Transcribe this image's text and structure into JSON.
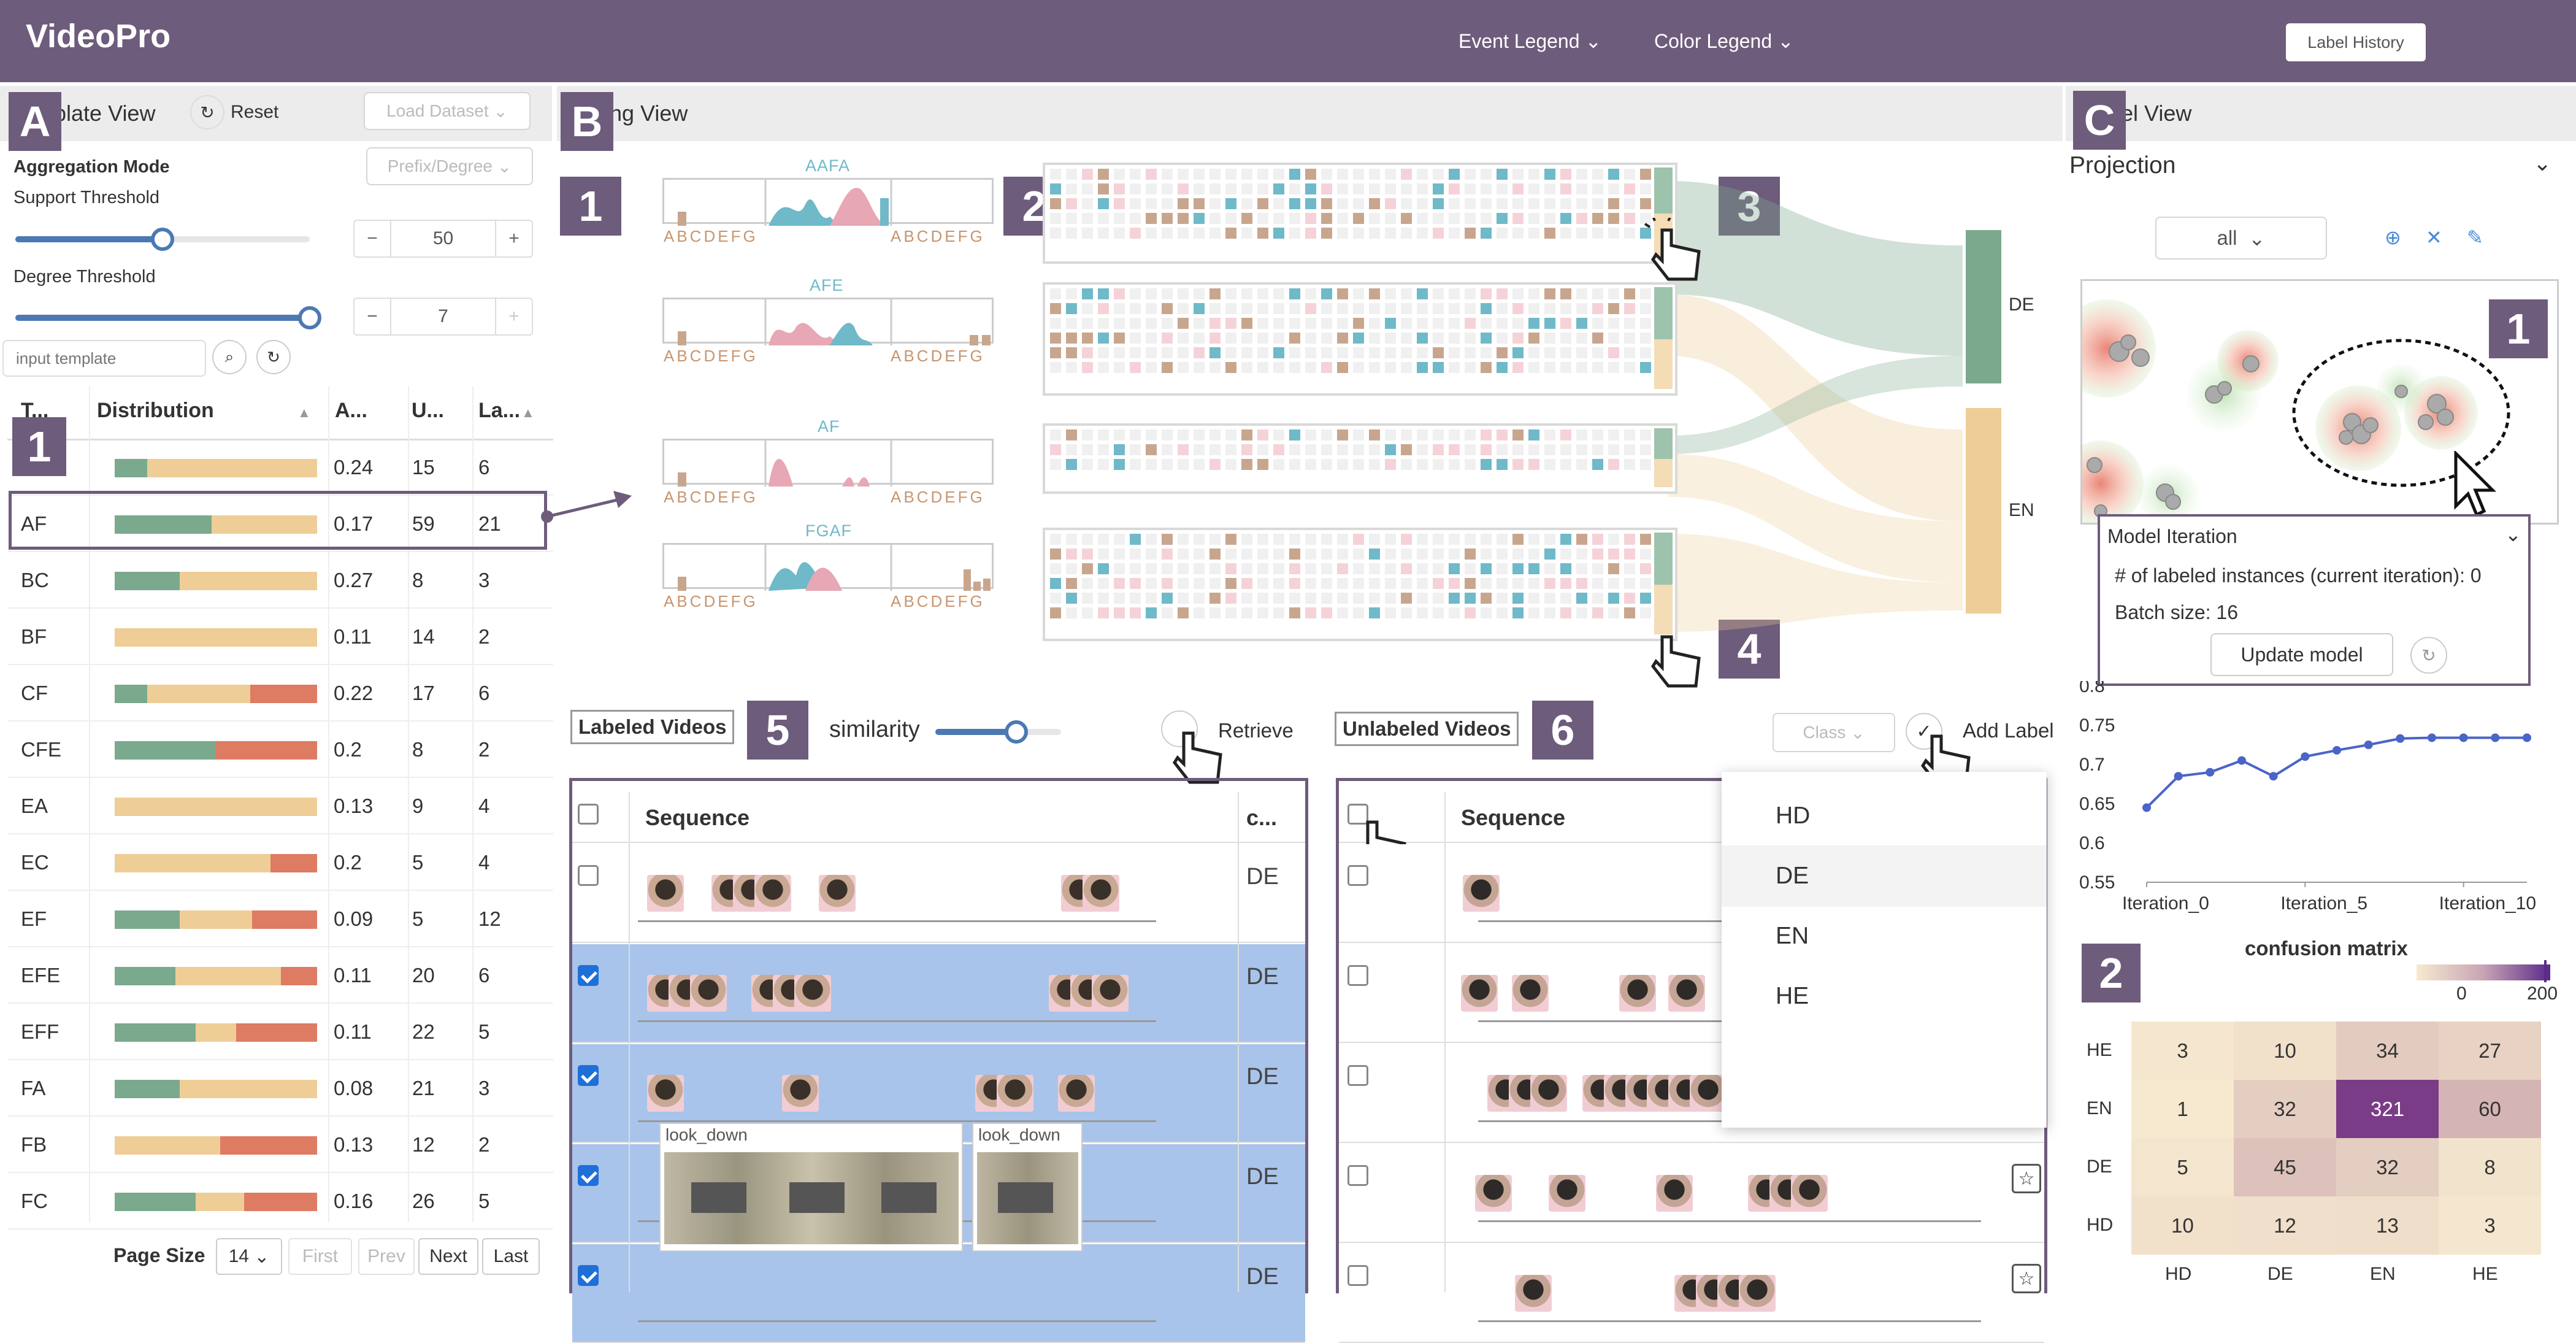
{
  "app": {
    "title": "VideoPro",
    "event_legend": "Event Legend",
    "color_legend": "Color Legend",
    "label_history": "Label History"
  },
  "template_view": {
    "title": "Template View",
    "badge": "A",
    "reset": "Reset",
    "load_dataset": "Load Dataset",
    "aggregation_mode_label": "Aggregation Mode",
    "aggregation_mode_value": "Prefix/Degree",
    "support_threshold_label": "Support Threshold",
    "support_threshold": "50",
    "degree_threshold_label": "Degree Threshold",
    "degree_threshold": "7",
    "input_placeholder": "input template",
    "table_badge": "1",
    "columns": [
      "T...",
      "Distribution",
      "A...",
      "U...",
      "La..."
    ],
    "rows": [
      {
        "t": "",
        "a": "0.24",
        "u": "15",
        "la": "6",
        "dist": [
          0.16,
          0.84,
          0
        ]
      },
      {
        "t": "AF",
        "a": "0.17",
        "u": "59",
        "la": "21",
        "dist": [
          0.48,
          0.52,
          0
        ]
      },
      {
        "t": "BC",
        "a": "0.27",
        "u": "8",
        "la": "3",
        "dist": [
          0.32,
          0.68,
          0
        ]
      },
      {
        "t": "BF",
        "a": "0.11",
        "u": "14",
        "la": "2",
        "dist": [
          0,
          1,
          0
        ]
      },
      {
        "t": "CF",
        "a": "0.22",
        "u": "17",
        "la": "6",
        "dist": [
          0.16,
          0.51,
          0.33
        ]
      },
      {
        "t": "CFE",
        "a": "0.2",
        "u": "8",
        "la": "2",
        "dist": [
          0.5,
          0,
          0.5
        ]
      },
      {
        "t": "EA",
        "a": "0.13",
        "u": "9",
        "la": "4",
        "dist": [
          0,
          1,
          0
        ]
      },
      {
        "t": "EC",
        "a": "0.2",
        "u": "5",
        "la": "4",
        "dist": [
          0,
          0.77,
          0.23
        ]
      },
      {
        "t": "EF",
        "a": "0.09",
        "u": "5",
        "la": "12",
        "dist": [
          0.32,
          0.36,
          0.32
        ]
      },
      {
        "t": "EFE",
        "a": "0.11",
        "u": "20",
        "la": "6",
        "dist": [
          0.3,
          0.52,
          0.18
        ]
      },
      {
        "t": "EFF",
        "a": "0.11",
        "u": "22",
        "la": "5",
        "dist": [
          0.4,
          0.2,
          0.4
        ]
      },
      {
        "t": "FA",
        "a": "0.08",
        "u": "21",
        "la": "3",
        "dist": [
          0.32,
          0.68,
          0
        ]
      },
      {
        "t": "FB",
        "a": "0.13",
        "u": "12",
        "la": "2",
        "dist": [
          0,
          0.52,
          0.48
        ]
      },
      {
        "t": "FC",
        "a": "0.16",
        "u": "26",
        "la": "5",
        "dist": [
          0.4,
          0.24,
          0.36
        ]
      }
    ],
    "page_size_label": "Page Size",
    "page_size": "14",
    "pager": [
      "First",
      "Prev",
      "Next",
      "Last"
    ]
  },
  "mining_view": {
    "title": "Mining View",
    "badge": "B",
    "sub_badges": [
      "1",
      "2",
      "3",
      "4",
      "5",
      "6"
    ],
    "templates": [
      "AAFA",
      "AFE",
      "AF",
      "FGAF"
    ],
    "axis_letters": "ABCDEFG",
    "sankey_labels": [
      "DE",
      "EN"
    ],
    "labeled_videos": "Labeled Videos",
    "similarity": "similarity",
    "retrieve": "Retrieve",
    "unlabeled_videos": "Unlabeled Videos",
    "class_placeholder": "Class",
    "add_label": "Add Label",
    "sequence_header": "Sequence",
    "class_header": "c...",
    "labeled_classes": [
      "DE",
      "DE",
      "DE",
      "DE",
      "DE"
    ],
    "tooltip_labels": [
      "look_down",
      "look_down"
    ],
    "dropdown_options": [
      "HD",
      "DE",
      "EN",
      "HE"
    ]
  },
  "model_view": {
    "title": "Model View",
    "badge": "C",
    "projection": "Projection",
    "filter": "all",
    "sub_badges": [
      "1",
      "2"
    ],
    "model_iteration": "Model Iteration",
    "labeled_instances": "# of labeled instances (current iteration): 0",
    "batch_size": "Batch size: 16",
    "update_model": "Update model"
  },
  "chart_data": [
    {
      "type": "line",
      "title": "",
      "x_ticks": [
        "Iteration_0",
        "Iteration_5",
        "Iteration_10"
      ],
      "x": [
        0,
        1,
        2,
        3,
        4,
        5,
        6,
        7,
        8,
        9,
        10,
        11,
        12
      ],
      "values": [
        0.645,
        0.685,
        0.69,
        0.705,
        0.685,
        0.71,
        0.718,
        0.725,
        0.733,
        0.734,
        0.734,
        0.734,
        0.734
      ],
      "y_ticks": [
        "0.8",
        "0.75",
        "0.7",
        "0.65",
        "0.6",
        "0.55"
      ],
      "ylim": [
        0.55,
        0.8
      ],
      "color": "#4a64c8"
    },
    {
      "type": "heatmap",
      "title": "confusion matrix",
      "rows": [
        "HE",
        "EN",
        "DE",
        "HD"
      ],
      "cols": [
        "HD",
        "DE",
        "EN",
        "HE"
      ],
      "values": [
        [
          3,
          10,
          34,
          27
        ],
        [
          1,
          32,
          321,
          60
        ],
        [
          5,
          45,
          32,
          8
        ],
        [
          10,
          12,
          13,
          3
        ]
      ],
      "scale_min": "0",
      "scale_max": "200"
    }
  ],
  "colors": {
    "accent": "#6e5c7c",
    "green": "#7ba98e",
    "orange": "#efcd97",
    "red": "#de7b63",
    "blue_sel": "#a9c4ea"
  }
}
